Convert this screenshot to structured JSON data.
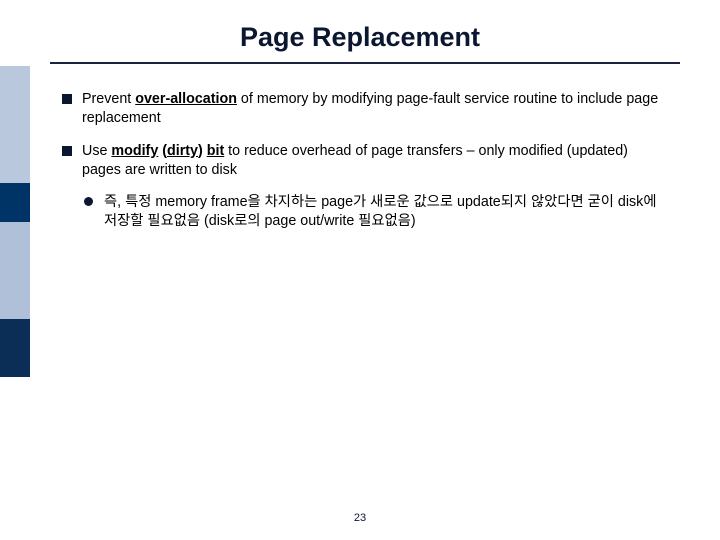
{
  "title": "Page Replacement",
  "bullets": [
    {
      "segments": [
        {
          "t": "Prevent ",
          "b": false,
          "u": false
        },
        {
          "t": "over-allocation",
          "b": true,
          "u": true
        },
        {
          "t": " of memory by modifying page-fault service routine to include page replacement",
          "b": false,
          "u": false
        }
      ]
    },
    {
      "segments": [
        {
          "t": "Use ",
          "b": false,
          "u": false
        },
        {
          "t": "modify",
          "b": true,
          "u": true
        },
        {
          "t": " (",
          "b": true,
          "u": false
        },
        {
          "t": "dirty",
          "b": true,
          "u": true
        },
        {
          "t": ") ",
          "b": true,
          "u": false
        },
        {
          "t": "bit",
          "b": true,
          "u": true
        },
        {
          "t": " to reduce overhead of page transfers – only modified (updated) pages are written to disk",
          "b": false,
          "u": false
        }
      ],
      "children": [
        {
          "segments": [
            {
              "t": "즉, 특정 memory frame을 차지하는 page가 새로운 값으로 update되지 않았다면 굳이 disk에 저장할 필요없음 (disk로의 page out/write 필요없음)",
              "b": false,
              "u": false
            }
          ]
        }
      ]
    }
  ],
  "page_number": "23"
}
